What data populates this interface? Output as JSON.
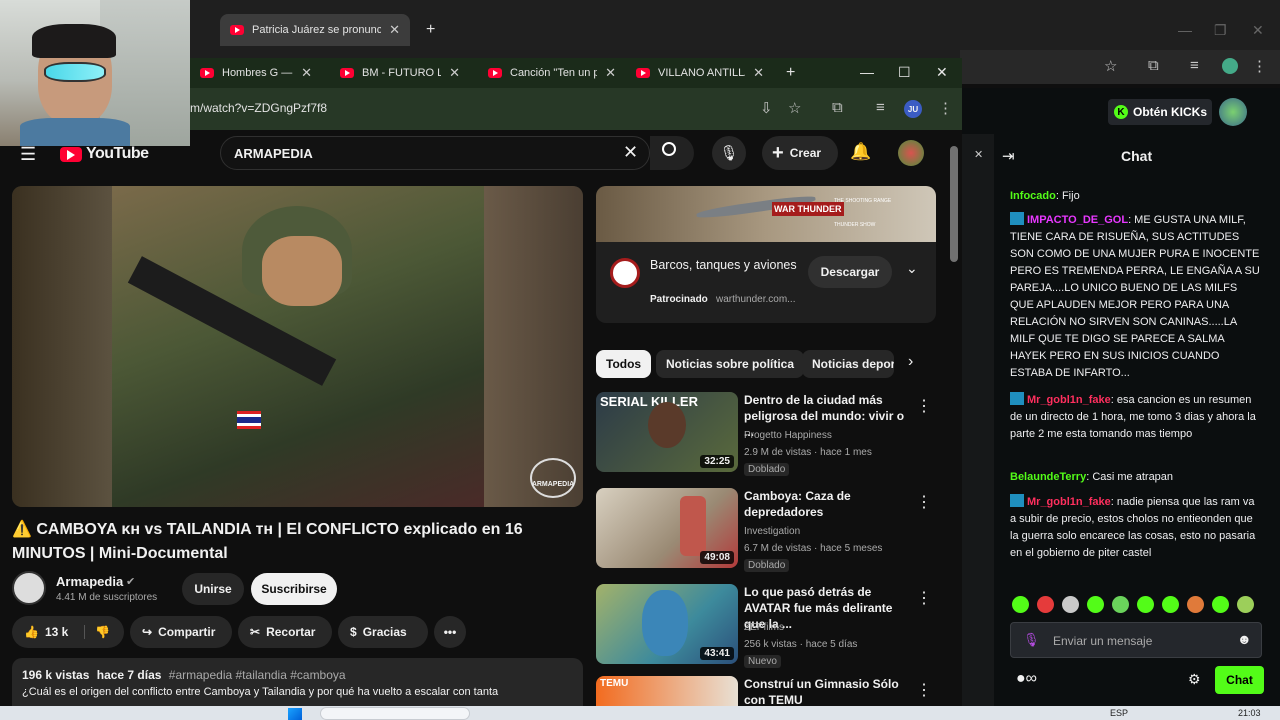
{
  "back_browser": {
    "tab_title": "Patricia Juárez se pronuncia y r",
    "new_tab": "+",
    "controls": {
      "minimize": "—",
      "maximize": "❐",
      "close": "✕"
    }
  },
  "front_browser": {
    "tabs": [
      {
        "title": "Hombres G — El Al"
      },
      {
        "title": "BM - FUTURO LUJO"
      },
      {
        "title": "Canción \"Ten un po"
      },
      {
        "title": "VILLANO ANTILLAN"
      }
    ],
    "new_tab": "+",
    "url": "m/watch?v=ZDGngPzf7f8",
    "profile_initials": "JU"
  },
  "youtube": {
    "logo_text": "YouTube",
    "search_value": "ARMAPEDIA",
    "create_label": "Crear",
    "video": {
      "watermark": "ARMAPEDIA",
      "title": "⚠️ CAMBOYA ᴋʜ vs TAILANDIA ᴛʜ | El CONFLICTO explicado en 16 MINUTOS | Mini-Documental",
      "channel": "Armapedia",
      "subscribers": "4.41 M de suscriptores",
      "join_label": "Unirse",
      "subscribe_label": "Suscribirse",
      "likes": "13 k",
      "share_label": "Compartir",
      "clip_label": "Recortar",
      "thanks_label": "Gracias",
      "views": "196 k vistas",
      "age": "hace 7 días",
      "hashtags": "#armapedia #tailandia #camboya",
      "description": "¿Cuál es el origen del conflicto entre Camboya y Tailandia y por qué ha vuelto a escalar con tanta"
    },
    "ad": {
      "title": "Barcos, tanques y aviones",
      "sponsored": "Patrocinado",
      "domain": "warthunder.com...",
      "cta": "Descargar",
      "banner_brand": "WAR THUNDER",
      "banner_small_1": "THE SHOOTING RANGE",
      "banner_small_2": "THUNDER SHOW"
    },
    "chips": [
      "Todos",
      "Noticias sobre política",
      "Noticias depor"
    ],
    "recommendations": [
      {
        "title": "Dentro de la ciudad más peligrosa del mundo: vivir o ...",
        "channel": "Progetto Happiness",
        "meta": "2.9 M de vistas · hace 1 mes",
        "badge": "Doblado",
        "duration": "32:25",
        "thumb_text": "SERIAL KILLER"
      },
      {
        "title": "Camboya: Caza de depredadores",
        "channel": "Investigation",
        "meta": "6.7 M de vistas · hace 5 meses",
        "badge": "Doblado",
        "duration": "49:08",
        "thumb_text": ""
      },
      {
        "title": "Lo que pasó detrás de AVATAR fue más delirante que la ...",
        "channel": "ZEPfilms",
        "meta": "256 k vistas · hace 5 días",
        "badge": "Nuevo",
        "duration": "43:41",
        "thumb_text": ""
      },
      {
        "title": "Construí un Gimnasio Sólo con TEMU",
        "channel": "",
        "meta": "",
        "badge": "",
        "duration": "",
        "thumb_text": "TEMU"
      }
    ]
  },
  "kick": {
    "get_kicks_label": "Obtén KICKs",
    "chat_title": "Chat",
    "messages": [
      {
        "user": "Infocado",
        "text": ": Fijo",
        "color": "#53fc18",
        "badge": false
      },
      {
        "user": "IMPACTO_DE_GOL",
        "text": ": ME GUSTA UNA MILF, TIENE CARA DE RISUEÑA, SUS ACTITUDES SON COMO DE UNA MUJER PURA E INOCENTE PERO ES TREMENDA PERRA, LE ENGAÑA A SU PAREJA....LO UNICO BUENO DE LAS MILFS QUE APLAUDEN MEJOR PERO PARA UNA RELACIÓN NO SIRVEN SON CANINAS.....LA MILF QUE TE DIGO SE PARECE A SALMA HAYEK PERO EN SUS INICIOS CUANDO ESTABA DE INFARTO...",
        "color": "#e838ff",
        "badge": true
      },
      {
        "user": "Mr_gobl1n_fake",
        "text": ": esa cancion es un resumen de un directo de 1 hora, me tomo 3 dias y ahora la parte 2 me esta tomando mas tiempo",
        "color": "#ff2f5e",
        "badge": true
      },
      {
        "user": "BelaundeTerry",
        "text": ": Casi me atrapan",
        "color": "#53fc18",
        "badge": false
      },
      {
        "user": "Mr_gobl1n_fake",
        "text": ": nadie piensa que las ram va a subir de precio, estos cholos no entieonden que la guerra solo encarece las cosas, esto no pasaria en el gobierno de piter castel",
        "color": "#ff2f5e",
        "badge": true
      }
    ],
    "input_placeholder": "Enviar un mensaje",
    "send_label": "Chat"
  },
  "taskbar": {
    "language": "ESP",
    "time": "21:03"
  }
}
